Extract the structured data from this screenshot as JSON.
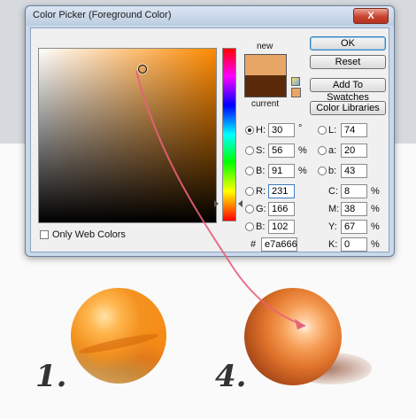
{
  "dialog": {
    "title": "Color Picker (Foreground Color)",
    "close_label": "X"
  },
  "swatch": {
    "new_label": "new",
    "current_label": "current",
    "new_color": "#e7a666",
    "current_color": "#5a2a0a"
  },
  "buttons": {
    "ok": "OK",
    "reset": "Reset",
    "add_to_swatches": "Add To Swatches",
    "color_libraries": "Color Libraries"
  },
  "hsb": {
    "h_label": "H:",
    "h_value": "30",
    "h_unit": "°",
    "s_label": "S:",
    "s_value": "56",
    "s_unit": "%",
    "b_label": "B:",
    "b_value": "91",
    "b_unit": "%"
  },
  "rgb": {
    "r_label": "R:",
    "r_value": "231",
    "g_label": "G:",
    "g_value": "166",
    "b_label": "B:",
    "b_value": "102"
  },
  "lab": {
    "l_label": "L:",
    "l_value": "74",
    "a_label": "a:",
    "a_value": "20",
    "b_label": "b:",
    "b_value": "43"
  },
  "cmyk": {
    "c_label": "C:",
    "c_value": "8",
    "c_unit": "%",
    "m_label": "M:",
    "m_value": "38",
    "m_unit": "%",
    "y_label": "Y:",
    "y_value": "67",
    "y_unit": "%",
    "k_label": "K:",
    "k_value": "0",
    "k_unit": "%"
  },
  "hex": {
    "label": "#",
    "value": "e7a666"
  },
  "web_colors": {
    "label": "Only Web Colors",
    "checked": false
  },
  "tutorial": {
    "step_a": "1.",
    "step_b": "4."
  },
  "colors": {
    "accent_arrow": "#e9607a",
    "hue_base": "#ff8a00"
  }
}
